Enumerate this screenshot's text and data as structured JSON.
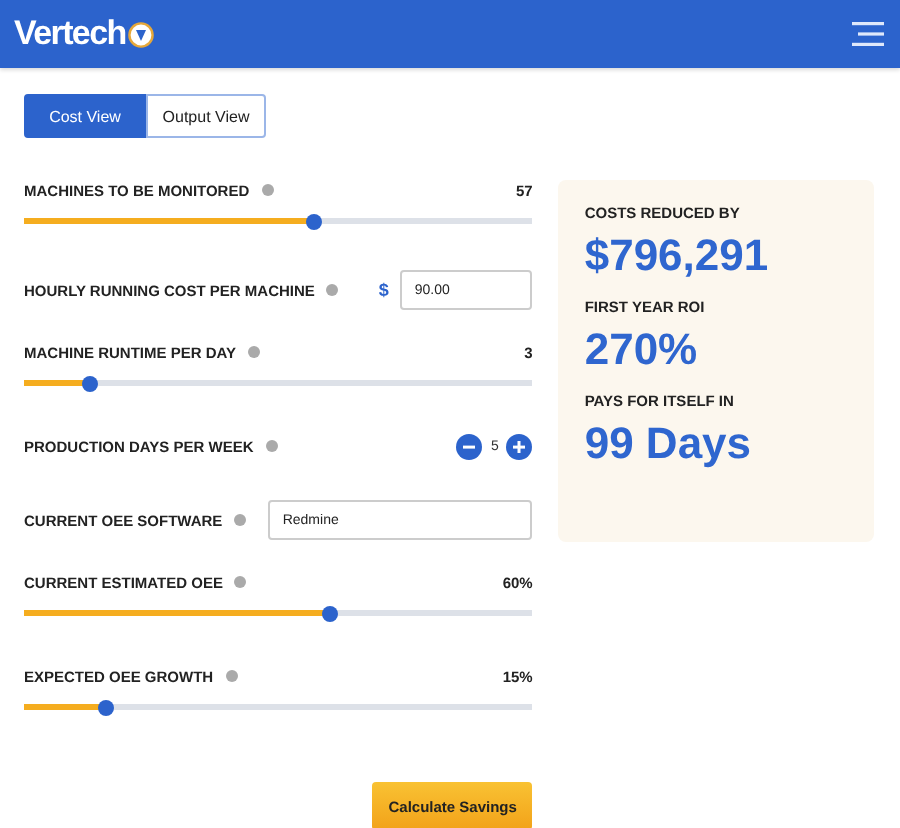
{
  "header": {
    "logo": "Vertech"
  },
  "tabs": [
    {
      "label": "Cost View",
      "selected": true
    },
    {
      "label": "Output View",
      "selected": false
    }
  ],
  "fields": [
    {
      "kind": "slider",
      "label": "MACHINES TO BE MONITORED",
      "reading": "57",
      "level": 0.57
    },
    {
      "kind": "input",
      "label": "HOURLY RUNNING COST PER MACHINE",
      "prefix": "$",
      "value": "90.00"
    },
    {
      "kind": "slider",
      "label": "MACHINE RUNTIME PER DAY",
      "reading": "3",
      "level": 0.13
    },
    {
      "kind": "stepper",
      "label": "PRODUCTION DAYS PER WEEK",
      "value": "5"
    },
    {
      "kind": "input",
      "label": "CURRENT OEE SOFTWARE",
      "value": "Redmine"
    },
    {
      "kind": "slider",
      "label": "CURRENT ESTIMATED OEE",
      "reading": "60%",
      "level": 0.6
    },
    {
      "kind": "slider",
      "label": "EXPECTED OEE GROWTH",
      "reading": "15%",
      "level": 0.16
    }
  ],
  "button": "Calculate Savings",
  "results": [
    {
      "label": "COSTS REDUCED BY",
      "value": "$796,291"
    },
    {
      "label": "FIRST YEAR ROI",
      "value": "270%"
    },
    {
      "label": "PAYS FOR ITSELF IN",
      "value": "99 Days"
    }
  ]
}
